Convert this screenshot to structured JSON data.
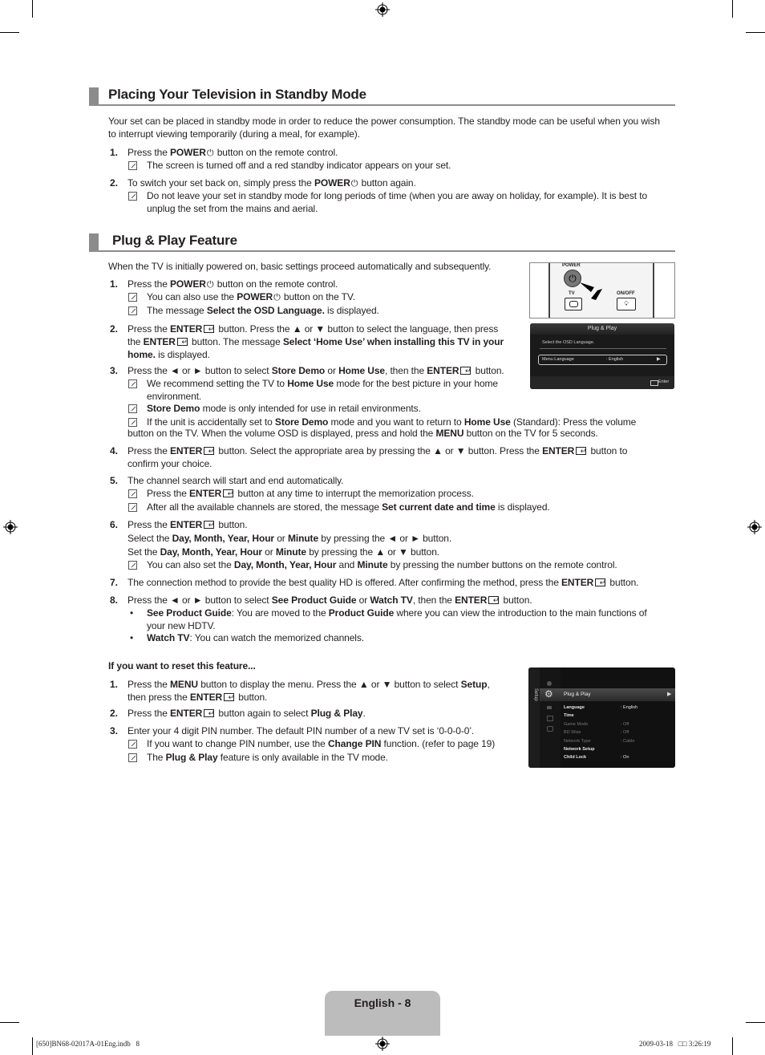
{
  "sections": {
    "standby": {
      "title": "Placing Your Television in Standby Mode",
      "intro": "Your set can be placed in standby mode in order to reduce the power consumption. The standby mode can be useful when you wish to interrupt viewing temporarily (during a meal, for example).",
      "steps": [
        {
          "num": "1.",
          "pre": "Press the ",
          "b1": "POWER",
          "post": " button on the remote control.",
          "notes": [
            "The screen is turned off and a red standby indicator appears on your set."
          ]
        },
        {
          "num": "2.",
          "pre": "To switch your set back on, simply press the ",
          "b1": "POWER",
          "post": " button again.",
          "notes": [
            "Do not leave your set in standby mode for long periods of time (when you are away on holiday, for example). It is best to unplug the set from the mains and aerial."
          ]
        }
      ]
    },
    "plugplay": {
      "title": "Plug & Play Feature",
      "intro": "When the TV is initially powered on, basic settings proceed automatically and subsequently.",
      "step1": {
        "num": "1.",
        "pre": "Press the ",
        "b1": "POWER",
        "post": " button on the remote control.",
        "note1_pre": "You can also use the ",
        "note1_b": "POWER",
        "note1_post": " button on the TV.",
        "note2_pre": "The message ",
        "note2_b": "Select the OSD Language.",
        "note2_post": " is displayed."
      },
      "step2": {
        "num": "2.",
        "l1_pre": "Press the ",
        "l1_b": "ENTER",
        "l1_post": " button. Press the ▲ or ▼ button to select the language, then press",
        "l2_pre": "the ",
        "l2_b1": "ENTER",
        "l2_mid": " button. The message ",
        "l2_b2": "Select ‘Home Use’ when installing this TV in your",
        "l3_b": "home.",
        "l3_post": " is displayed."
      },
      "step3": {
        "num": "3.",
        "pre": "Press the ◄ or ► button to select ",
        "b1": "Store Demo",
        "mid1": " or ",
        "b2": "Home Use",
        "mid2": ", then the ",
        "b3": "ENTER",
        "post": " button.",
        "note1_pre": "We recommend setting the TV to ",
        "note1_b": "Home Use",
        "note1_post": " mode for the best picture in your home",
        "note1_l2": "environment.",
        "note2_b": "Store Demo",
        "note2_post": " mode is only intended for use in retail environments.",
        "note3_pre": "If the unit is accidentally set to ",
        "note3_b1": "Store Demo",
        "note3_mid": " mode and you want to return to ",
        "note3_b2": "Home Use",
        "note3_post": " (Standard): Press the volume",
        "note3_l2_pre": "button on the TV. When the volume OSD is displayed, press and hold the ",
        "note3_l2_b": "MENU",
        "note3_l2_post": " button on the TV for 5 seconds."
      },
      "step4": {
        "num": "4.",
        "pre": "Press the ",
        "b1": "ENTER",
        "mid": " button. Select the appropriate area by pressing the ▲ or ▼ button. Press the ",
        "b2": "ENTER",
        "post": " button to",
        "l2": "confirm your choice."
      },
      "step5": {
        "num": "5.",
        "text": "The channel search will start and end automatically.",
        "note1_pre": "Press the ",
        "note1_b": "ENTER",
        "note1_post": " button at any time to interrupt the memorization process.",
        "note2_pre": "After all the available channels are stored, the message ",
        "note2_b": "Set current date and time",
        "note2_post": " is displayed."
      },
      "step6": {
        "num": "6.",
        "pre": "Press the ",
        "b1": "ENTER",
        "post": " button.",
        "l2_pre": "Select the ",
        "l2_b1": "Day, Month, Year, Hour",
        "l2_mid": " or ",
        "l2_b2": "Minute",
        "l2_post": " by pressing the ◄ or ► button.",
        "l3_pre": "Set the ",
        "l3_b1": "Day, Month, Year, Hour",
        "l3_mid": " or ",
        "l3_b2": "Minute",
        "l3_post": " by pressing the ▲ or ▼ button.",
        "note_pre": "You can also set the ",
        "note_b1": "Day, Month, Year, Hour",
        "note_mid": " and ",
        "note_b2": "Minute",
        "note_post": " by pressing the number buttons on the remote control."
      },
      "step7": {
        "num": "7.",
        "pre": "The connection method to provide the best quality HD is offered. After confirming the method, press the ",
        "b1": "ENTER",
        "post": " button."
      },
      "step8": {
        "num": "8.",
        "pre": "Press the ◄ or ► button to select ",
        "b1": "See Product Guide",
        "mid1": " or ",
        "b2": "Watch TV",
        "mid2": ", then the ",
        "b3": "ENTER",
        "post": " button.",
        "bullet1_b": "See Product Guide",
        "bullet1_mid": ": You are moved to the ",
        "bullet1_b2": "Product Guide",
        "bullet1_post": " where you can view the introduction to the main functions of",
        "bullet1_l2": "your new HDTV.",
        "bullet2_b": "Watch TV",
        "bullet2_post": ": You can watch the memorized channels."
      },
      "reset": {
        "heading": "If you want to reset this feature...",
        "s1": {
          "num": "1.",
          "pre": "Press the ",
          "b1": "MENU",
          "mid": " button to display the menu. Press the ▲ or ▼ button to select ",
          "b2": "Setup",
          "post": ",",
          "l2_pre": "then press the ",
          "l2_b": "ENTER",
          "l2_post": " button."
        },
        "s2": {
          "num": "2.",
          "pre": "Press the ",
          "b1": "ENTER",
          "mid": " button again to select ",
          "b2": "Plug & Play",
          "post": "."
        },
        "s3": {
          "num": "3.",
          "text": "Enter your 4 digit PIN number. The default PIN number of a new TV set is ‘0-0-0-0’.",
          "note1_pre": "If you want to change PIN number, use the ",
          "note1_b": "Change PIN",
          "note1_post": " function. (refer to page 19)",
          "note2_pre": "The ",
          "note2_b": "Plug & Play",
          "note2_post": " feature is only available in the TV mode."
        }
      }
    }
  },
  "figures": {
    "remote": {
      "power_label": "POWER",
      "tv_label": "TV",
      "onoff_label": "ON/OFF"
    },
    "osd_language": {
      "title": "Plug & Play",
      "message": "Select the OSD Language.",
      "row_label": "Menu Language",
      "row_value": ": English",
      "enter_label": "Enter"
    },
    "setup_menu": {
      "side_label": "Setup",
      "highlight": "Plug & Play",
      "items": [
        {
          "label": "Language",
          "value": ": English",
          "dim": false
        },
        {
          "label": "Time",
          "value": "",
          "dim": false
        },
        {
          "label": "Game Mode",
          "value": ": Off",
          "dim": true
        },
        {
          "label": "BD Wise",
          "value": ": Off",
          "dim": true
        },
        {
          "label": "Network Type",
          "value": ": Cable",
          "dim": true
        },
        {
          "label": "Network Setup",
          "value": "",
          "dim": false
        },
        {
          "label": "Child Lock",
          "value": ": On",
          "dim": false
        }
      ]
    }
  },
  "footer": {
    "page_label": "English - 8",
    "file_info": "[650]BN68-02017A-01Eng.indb   8",
    "timestamp": "2009-03-18   □□ 3:26:19"
  }
}
